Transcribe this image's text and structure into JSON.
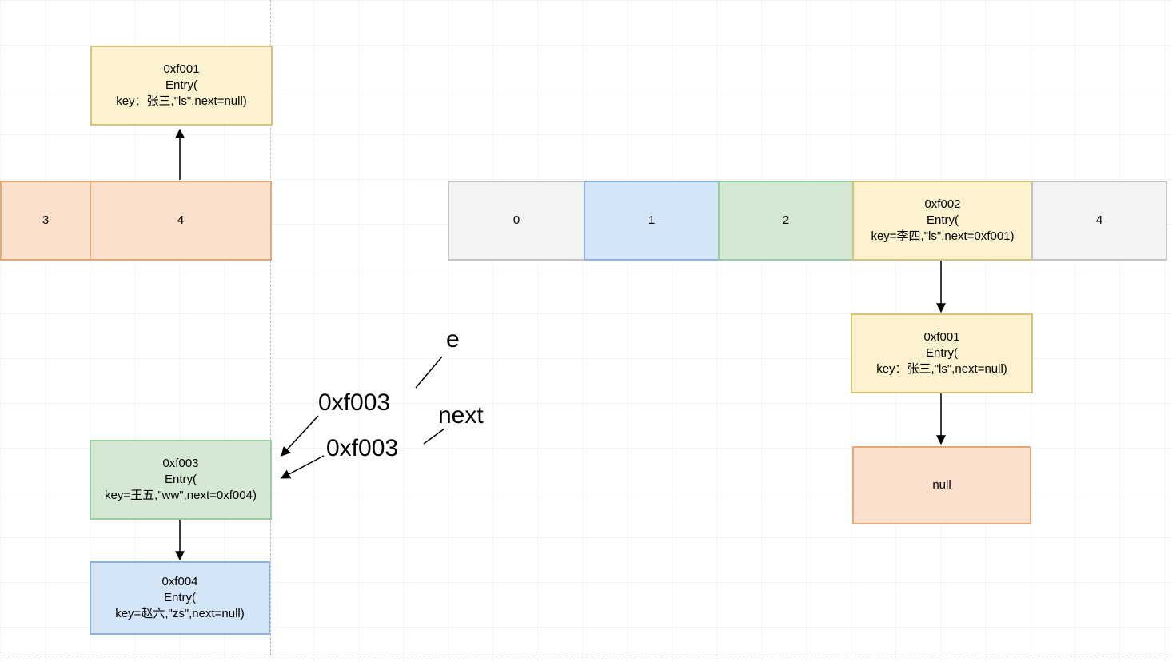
{
  "nodes": {
    "top_entry": {
      "addr": "0xf001",
      "label": "Entry(",
      "detail": "key：张三,\"ls\",next=null)"
    },
    "cell_left_3": "3",
    "cell_left_4": "4",
    "green_entry": {
      "addr": "0xf003",
      "label": "Entry(",
      "detail": "key=王五,\"ww\",next=0xf004)"
    },
    "blue_entry": {
      "addr": "0xf004",
      "label": "Entry(",
      "detail": "key=赵六,\"zs\",next=null)"
    },
    "cell_r0": "0",
    "cell_r1": "1",
    "cell_r2": "2",
    "cell_r3": {
      "addr": "0xf002",
      "label": "Entry(",
      "detail": "key=李四,\"ls\",next=0xf001)"
    },
    "cell_r4": "4",
    "right_entry": {
      "addr": "0xf001",
      "label": "Entry(",
      "detail": "key：张三,\"ls\",next=null)"
    },
    "null_box": "null"
  },
  "labels": {
    "e": "e",
    "addr_e": "0xf003",
    "next": "next",
    "addr_next": "0xf003"
  }
}
